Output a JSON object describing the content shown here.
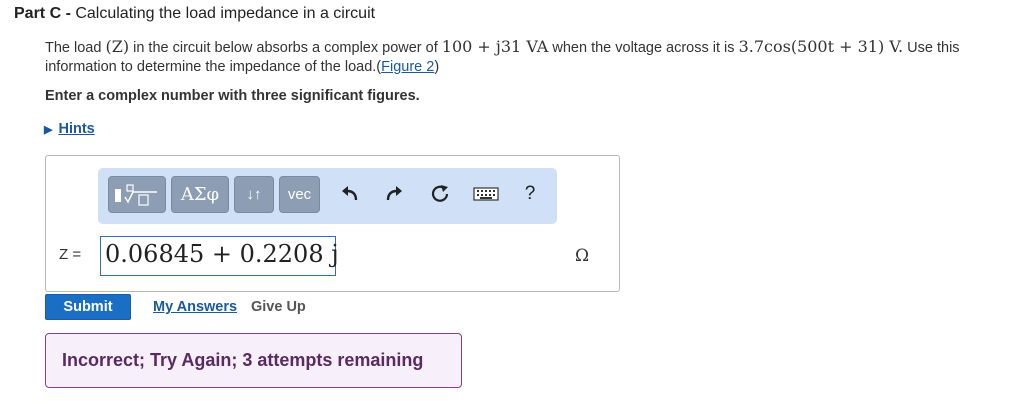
{
  "part": {
    "label": "Part C",
    "separator": " - ",
    "title": "Calculating the load impedance in a circuit"
  },
  "problem": {
    "t1": "The load ",
    "m1": "(Z)",
    "t2": " in the circuit below absorbs a complex power of ",
    "m2": "100 + j31 VA",
    "t3": " when the voltage across it is ",
    "m3": "3.7cos(500t + 31) V.",
    "t4": " Use this information to determine the impedance of the load.(",
    "figure_link": "Figure 2",
    "t5": ")"
  },
  "instruction": "Enter a complex number with three significant figures.",
  "hints_label": "Hints",
  "toolbar": {
    "templates_icon": "templates-icon",
    "greek_label": "ΑΣφ",
    "arrows_label": "↓↑",
    "vec_label": "vec",
    "help_label": "?"
  },
  "answer": {
    "variable_label": "Z =",
    "value": "0.06845 + 0.2208 j",
    "unit": "Ω"
  },
  "actions": {
    "submit": "Submit",
    "my_answers": "My Answers",
    "give_up": "Give Up"
  },
  "feedback": "Incorrect; Try Again; 3 attempts remaining",
  "colors": {
    "link": "#1a5a9c",
    "submit_bg": "#1a6fc4",
    "toolbar_bg": "#cfe0f7",
    "feedback_border": "#8a3f8e"
  }
}
